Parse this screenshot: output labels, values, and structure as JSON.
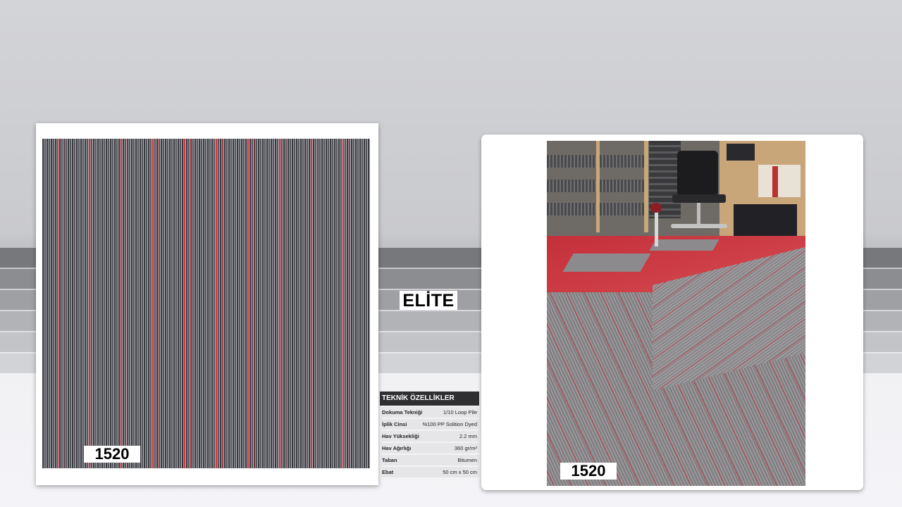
{
  "brand": "ELİTE",
  "product_code_left": "1520",
  "product_code_right": "1520",
  "specs": {
    "title": "TEKNİK ÖZELLİKLER",
    "rows": [
      {
        "label": "Dokuma Tekniği",
        "value": "1/10 Loop Pile"
      },
      {
        "label": "İplik Cinsi",
        "value": "%100 PP Solition Dyed"
      },
      {
        "label": "Hav Yüksekliği",
        "value": "2.2 mm"
      },
      {
        "label": "Hav Ağırlığı",
        "value": "360 gr/m²"
      },
      {
        "label": "Taban",
        "value": "Bitumen"
      },
      {
        "label": "Ebat",
        "value": "50 cm x 50 cm"
      }
    ]
  },
  "colors": {
    "accent_red": "#de303e",
    "carpet_grey": "#505156",
    "stripe_dark": "#77787c"
  }
}
